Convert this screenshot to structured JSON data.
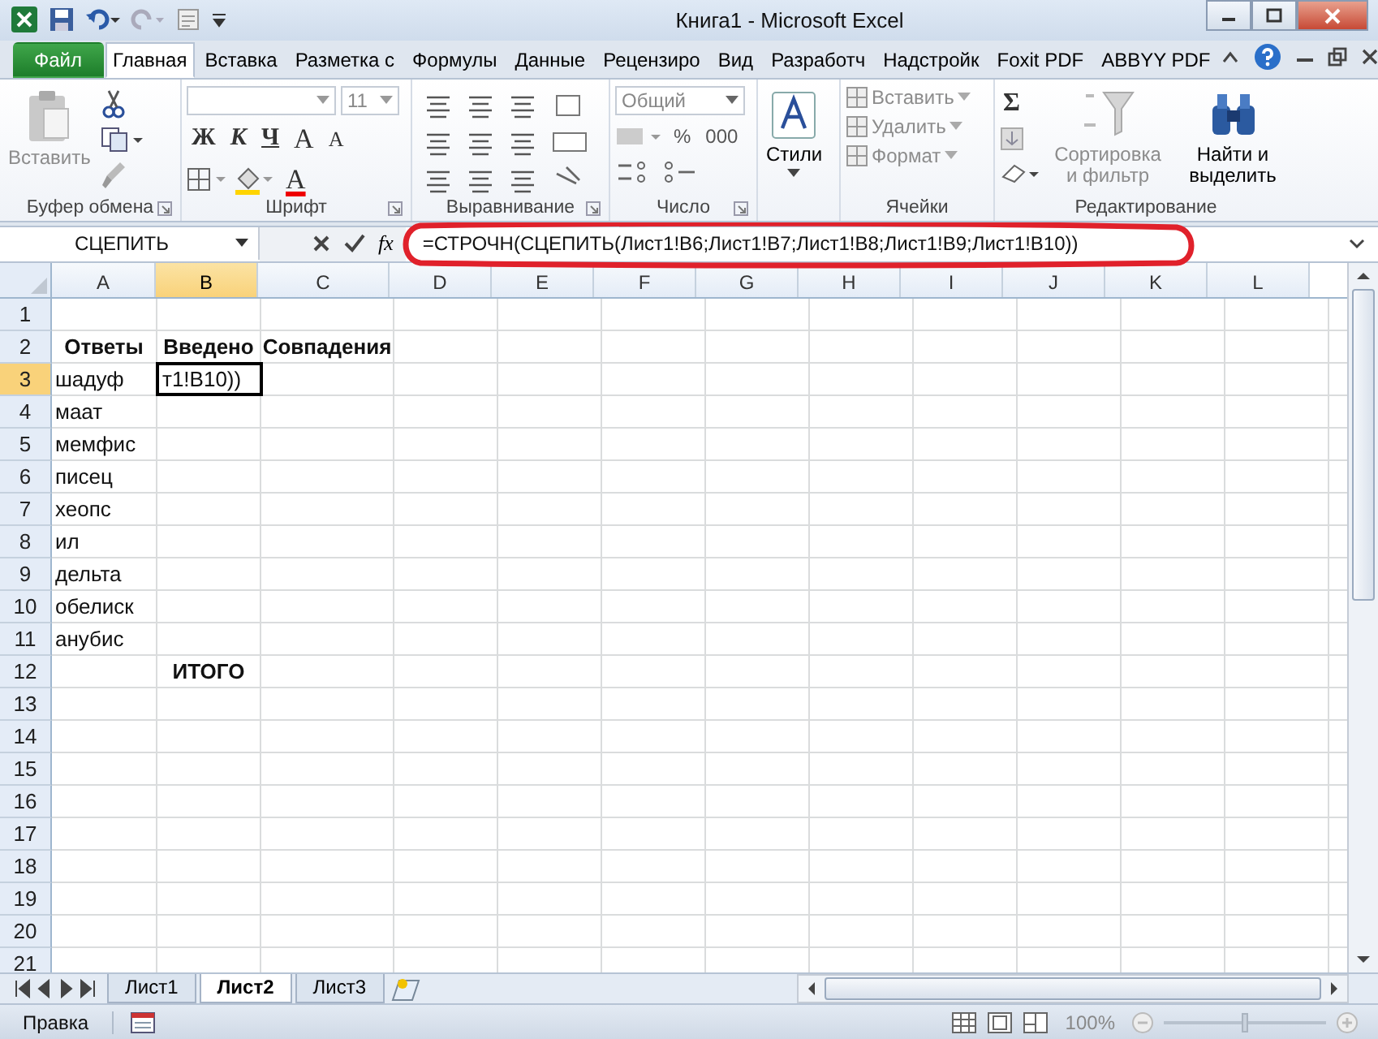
{
  "window": {
    "title": "Книга1  -  Microsoft Excel"
  },
  "ribbon_tabs": [
    {
      "label": "Файл",
      "kind": "file",
      "selected": false
    },
    {
      "label": "Главная",
      "kind": "tab",
      "selected": true
    },
    {
      "label": "Вставка",
      "kind": "tab",
      "selected": false
    },
    {
      "label": "Разметка с",
      "kind": "tab",
      "selected": false
    },
    {
      "label": "Формулы",
      "kind": "tab",
      "selected": false
    },
    {
      "label": "Данные",
      "kind": "tab",
      "selected": false
    },
    {
      "label": "Рецензиро",
      "kind": "tab",
      "selected": false
    },
    {
      "label": "Вид",
      "kind": "tab",
      "selected": false
    },
    {
      "label": "Разработч",
      "kind": "tab",
      "selected": false
    },
    {
      "label": "Надстройк",
      "kind": "tab",
      "selected": false
    },
    {
      "label": "Foxit PDF",
      "kind": "tab",
      "selected": false
    },
    {
      "label": "ABBYY PDF",
      "kind": "tab",
      "selected": false
    }
  ],
  "ribbon_groups": [
    {
      "kind": "clipboard",
      "label": "Буфер обмена",
      "paste": {
        "label": "Вставить",
        "disabled": true
      }
    },
    {
      "kind": "font",
      "label": "Шрифт",
      "size": "11",
      "bold": "Ж",
      "italic": "К",
      "underline": "Ч",
      "grow": "A",
      "shrink": "A",
      "font_color": "A"
    },
    {
      "kind": "alignment",
      "label": "Выравнивание"
    },
    {
      "kind": "number",
      "label": "Число",
      "format": "Общий",
      "percent": "%",
      "thousands": "000"
    },
    {
      "kind": "styles",
      "button": "Стили"
    },
    {
      "kind": "cells",
      "label": "Ячейки",
      "items": [
        {
          "label": "Вставить",
          "disabled": true
        },
        {
          "label": "Удалить",
          "disabled": true
        },
        {
          "label": "Формат",
          "disabled": true
        }
      ]
    },
    {
      "kind": "editing",
      "label": "Редактирование",
      "sum": "Σ",
      "sort": {
        "label": "Сортировка и фильтр",
        "disabled": true
      },
      "find": {
        "label": "Найти и выделить",
        "disabled": false
      }
    }
  ],
  "formula_bar": {
    "name_box": "СЦЕПИТЬ",
    "function_label": "fx",
    "formula": "=СТРОЧН(СЦЕПИТЬ(Лист1!B6;Лист1!B7;Лист1!B8;Лист1!B9;Лист1!B10))"
  },
  "sheet": {
    "columns": [
      {
        "label": "A",
        "selected": false
      },
      {
        "label": "B",
        "selected": true
      },
      {
        "label": "C",
        "selected": false
      },
      {
        "label": "D",
        "selected": false
      },
      {
        "label": "E",
        "selected": false
      },
      {
        "label": "F",
        "selected": false
      },
      {
        "label": "G",
        "selected": false
      },
      {
        "label": "H",
        "selected": false
      },
      {
        "label": "I",
        "selected": false
      },
      {
        "label": "J",
        "selected": false
      },
      {
        "label": "K",
        "selected": false
      },
      {
        "label": "L",
        "selected": false
      }
    ],
    "rows": [
      {
        "number": "1",
        "selected": false,
        "cells": []
      },
      {
        "number": "2",
        "selected": false,
        "cells": [
          {
            "text": "Ответы",
            "bold": true,
            "active": false
          },
          {
            "text": "Введено",
            "bold": true,
            "active": false
          },
          {
            "text": "Совпадения",
            "bold": true,
            "active": false
          }
        ]
      },
      {
        "number": "3",
        "selected": true,
        "cells": [
          {
            "text": "шадуф",
            "bold": false,
            "active": false
          },
          {
            "text": "т1!B10))",
            "bold": false,
            "active": true
          }
        ]
      },
      {
        "number": "4",
        "selected": false,
        "cells": [
          {
            "text": "маат",
            "bold": false,
            "active": false
          }
        ]
      },
      {
        "number": "5",
        "selected": false,
        "cells": [
          {
            "text": "мемфис",
            "bold": false,
            "active": false
          }
        ]
      },
      {
        "number": "6",
        "selected": false,
        "cells": [
          {
            "text": "писец",
            "bold": false,
            "active": false
          }
        ]
      },
      {
        "number": "7",
        "selected": false,
        "cells": [
          {
            "text": "хеопс",
            "bold": false,
            "active": false
          }
        ]
      },
      {
        "number": "8",
        "selected": false,
        "cells": [
          {
            "text": "ил",
            "bold": false,
            "active": false
          }
        ]
      },
      {
        "number": "9",
        "selected": false,
        "cells": [
          {
            "text": "дельта",
            "bold": false,
            "active": false
          }
        ]
      },
      {
        "number": "10",
        "selected": false,
        "cells": [
          {
            "text": "обелиск",
            "bold": false,
            "active": false
          }
        ]
      },
      {
        "number": "11",
        "selected": false,
        "cells": [
          {
            "text": "анубис",
            "bold": false,
            "active": false
          }
        ]
      },
      {
        "number": "12",
        "selected": false,
        "cells": [
          null,
          {
            "text": "ИТОГО",
            "bold": true,
            "active": false
          }
        ]
      },
      {
        "number": "13",
        "selected": false,
        "cells": []
      },
      {
        "number": "14",
        "selected": false,
        "cells": []
      },
      {
        "number": "15",
        "selected": false,
        "cells": []
      },
      {
        "number": "16",
        "selected": false,
        "cells": []
      },
      {
        "number": "17",
        "selected": false,
        "cells": []
      },
      {
        "number": "18",
        "selected": false,
        "cells": []
      },
      {
        "number": "19",
        "selected": false,
        "cells": []
      },
      {
        "number": "20",
        "selected": false,
        "cells": []
      },
      {
        "number": "21",
        "selected": false,
        "cells": []
      }
    ]
  },
  "sheet_tabs": [
    {
      "label": "Лист1",
      "selected": false
    },
    {
      "label": "Лист2",
      "selected": true
    },
    {
      "label": "Лист3",
      "selected": false
    }
  ],
  "status_bar": {
    "mode": "Правка",
    "zoom": "100%",
    "zoom_slider": {
      "level": 0.5
    }
  }
}
